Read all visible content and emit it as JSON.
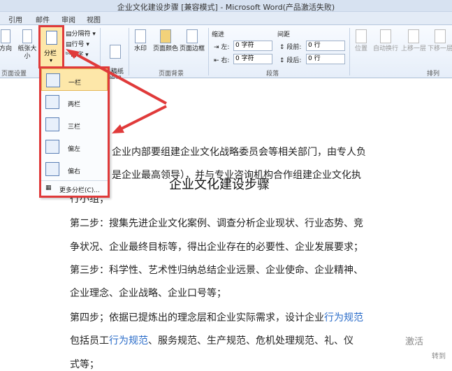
{
  "window": {
    "title": "企业文化建设步骤 [兼容模式] - Microsoft Word(产品激活失败)"
  },
  "tabs": [
    "引用",
    "邮件",
    "审阅",
    "视图"
  ],
  "ribbon": {
    "page_setup": {
      "label": "页面设置",
      "direction": "方向",
      "paper_size": "纸张大小",
      "columns": "分栏",
      "breaks": "分隔符",
      "line_numbers": "行号",
      "hyphenation": "断字"
    },
    "draft": {
      "label": "稿纸\n设置"
    },
    "background": {
      "label": "页面背景",
      "watermark": "水印",
      "page_color": "页面颜色",
      "page_border": "页面边框"
    },
    "paragraph": {
      "label": "段落",
      "indent": "缩进",
      "left": "左:",
      "right": "右:",
      "left_val": "0 字符",
      "right_val": "0 字符",
      "spacing": "间距",
      "before": "段前:",
      "after": "段后:",
      "before_val": "0 行",
      "after_val": "0 行"
    },
    "arrange": {
      "label": "排列",
      "position": "位置",
      "wrap": "自动换行",
      "forward": "上移一层",
      "backward": "下移一层"
    }
  },
  "columns_menu": {
    "items": [
      "一栏",
      "两栏",
      "三栏",
      "偏左",
      "偏右"
    ],
    "more": "更多分栏(C)..."
  },
  "document": {
    "heading": "企业文化建设步骤",
    "lines": [
      "企业内部要组建企业文化战略委员会等相关部门，由专人负",
      "是企业最高领导），并与专业咨询机构合作组建企业文化执",
      "行小组；",
      "第二步：搜集先进企业文化案例、调查分析企业现状、行业态势、竞",
      "争状况、企业最终目标等，得出企业存在的必要性、企业发展要求；",
      "第三步：科学性、艺术性归纳总结企业远景、企业使命、企业精神、",
      "企业理念、企业战略、企业口号等；",
      "第四步；依据已提炼出的理念层和企业实际需求，设计企业",
      "包括员工",
      "、服务规范、生产规范、危机处理规范、",
      "式等；"
    ],
    "link1": "行为规范",
    "link2": "行为规范",
    "tail8": "礼、仪",
    "activate": "激活",
    "goto": "转到"
  },
  "colors": {
    "highlight_red": "#e03a3a",
    "link_blue": "#2a6cc9"
  }
}
